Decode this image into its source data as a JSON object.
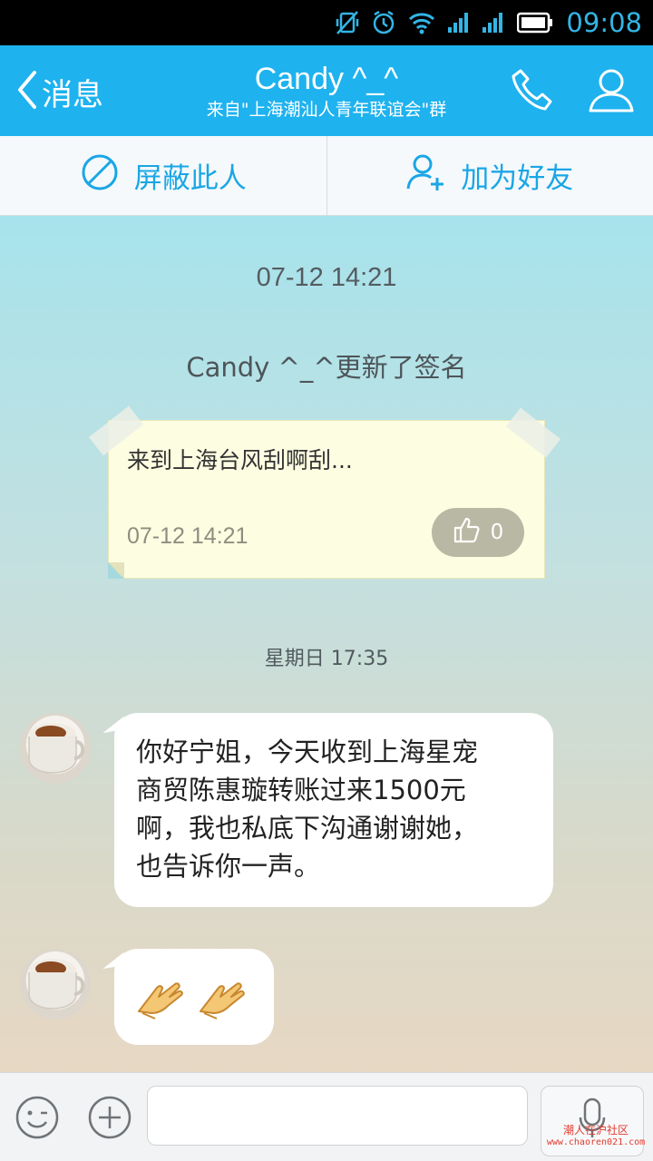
{
  "status_bar": {
    "time": "09:08"
  },
  "header": {
    "back_label": "消息",
    "title": "Candy ^_^",
    "subtitle": "来自\"上海潮汕人青年联谊会\"群"
  },
  "actions": {
    "block_label": "屏蔽此人",
    "add_friend_label": "加为好友"
  },
  "chat": {
    "timestamp_1": "07-12 14:21",
    "signature_notice": "Candy ^_^更新了签名",
    "signature_card": {
      "text": "来到上海台风刮啊刮...",
      "time": "07-12 14:21",
      "likes": "0"
    },
    "timestamp_2": "星期日 17:35",
    "messages": [
      {
        "lines": [
          "你好宁姐，今天收到上海星宠",
          "商贸陈惠璇转账过来1500元",
          "啊，我也私底下沟通谢谢她，",
          "也告诉你一声。"
        ]
      },
      {
        "emoji": "fist-clap"
      }
    ]
  },
  "watermark": {
    "line1": "潮人在沪社区",
    "line2": "www.chaoren021.com"
  },
  "colors": {
    "accent": "#1eb2ef",
    "status_blue": "#33b5e5",
    "action_blue": "#1aa6e6"
  }
}
